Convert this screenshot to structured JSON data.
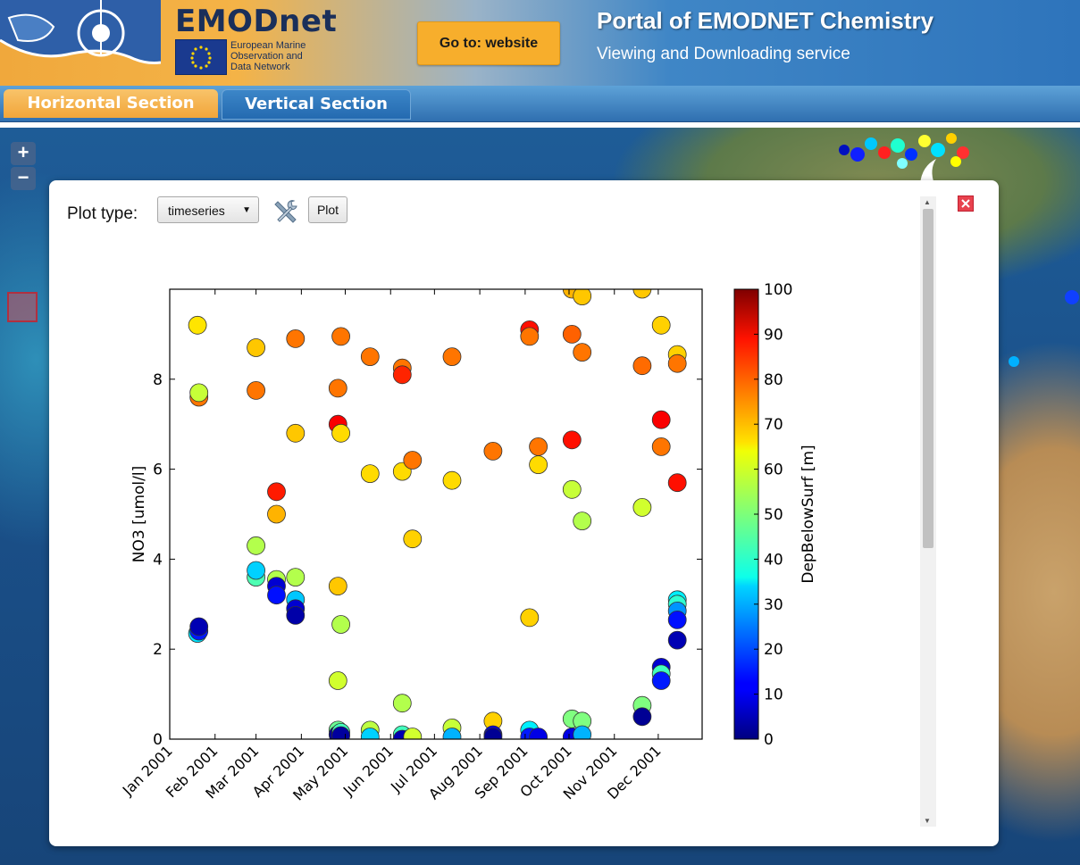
{
  "header": {
    "brand_name": "EMODnet",
    "brand_tagline_1": "European Marine",
    "brand_tagline_2": "Observation and",
    "brand_tagline_3": "Data Network",
    "goto_label": "Go to: website",
    "portal_title": "Portal of EMODNET Chemistry",
    "portal_subtitle": "Viewing and Downloading service"
  },
  "tabs": [
    {
      "label": "Horizontal Section",
      "active": true
    },
    {
      "label": "Vertical Section",
      "active": false
    }
  ],
  "map": {
    "zoom_in": "+",
    "zoom_out": "−"
  },
  "panel": {
    "plot_type_label": "Plot type:",
    "plot_type_value": "timeseries",
    "plot_button": "Plot",
    "close_icon": "close-icon",
    "tools_icon": "tools-icon"
  },
  "colors": {
    "header_orange": "#f4b347",
    "header_blue": "#2e74bb",
    "tab_active": "#f2a63a",
    "tab_inactive": "#246ab0",
    "goto_button": "#f7ae2c"
  },
  "chart_data": {
    "type": "scatter",
    "xlabel": "",
    "ylabel": "NO3 [umol/l]",
    "colorbar_label": "DepBelowSurf [m]",
    "x_tick_labels": [
      "Jan 2001",
      "Feb 2001",
      "Mar 2001",
      "Apr 2001",
      "May 2001",
      "Jun 2001",
      "Jul 2001",
      "Aug 2001",
      "Sep 2001",
      "Oct 2001",
      "Nov 2001",
      "Dec 2001"
    ],
    "xlim": [
      "2001-01-01",
      "2001-12-31"
    ],
    "ylim": [
      0,
      10
    ],
    "y_ticks": [
      0,
      2,
      4,
      6,
      8
    ],
    "colorbar_range": [
      0,
      100
    ],
    "colorbar_ticks": [
      0,
      10,
      20,
      30,
      40,
      50,
      60,
      70,
      80,
      90,
      100
    ],
    "colormap": "jet",
    "grid": false,
    "points": [
      {
        "date": "2001-01-20",
        "no3": 9.2,
        "depth": 65
      },
      {
        "date": "2001-01-21",
        "no3": 7.6,
        "depth": 76
      },
      {
        "date": "2001-01-21",
        "no3": 7.7,
        "depth": 57
      },
      {
        "date": "2001-01-20",
        "no3": 2.35,
        "depth": 35
      },
      {
        "date": "2001-01-21",
        "no3": 2.4,
        "depth": 15
      },
      {
        "date": "2001-01-21",
        "no3": 2.5,
        "depth": 5
      },
      {
        "date": "2001-03-01",
        "no3": 8.7,
        "depth": 68
      },
      {
        "date": "2001-03-01",
        "no3": 7.75,
        "depth": 76
      },
      {
        "date": "2001-03-01",
        "no3": 4.3,
        "depth": 55
      },
      {
        "date": "2001-03-01",
        "no3": 3.6,
        "depth": 45
      },
      {
        "date": "2001-03-01",
        "no3": 3.75,
        "depth": 33
      },
      {
        "date": "2001-03-15",
        "no3": 5.5,
        "depth": 85
      },
      {
        "date": "2001-03-15",
        "no3": 5.0,
        "depth": 70
      },
      {
        "date": "2001-03-15",
        "no3": 3.55,
        "depth": 55
      },
      {
        "date": "2001-03-15",
        "no3": 3.4,
        "depth": 8
      },
      {
        "date": "2001-03-15",
        "no3": 3.2,
        "depth": 14
      },
      {
        "date": "2001-03-28",
        "no3": 8.9,
        "depth": 76
      },
      {
        "date": "2001-03-28",
        "no3": 6.8,
        "depth": 68
      },
      {
        "date": "2001-03-28",
        "no3": 3.6,
        "depth": 55
      },
      {
        "date": "2001-03-28",
        "no3": 3.1,
        "depth": 32
      },
      {
        "date": "2001-03-28",
        "no3": 2.9,
        "depth": 8
      },
      {
        "date": "2001-03-28",
        "no3": 2.75,
        "depth": 4
      },
      {
        "date": "2001-04-26",
        "no3": 7.8,
        "depth": 76
      },
      {
        "date": "2001-04-26",
        "no3": 7.0,
        "depth": 88
      },
      {
        "date": "2001-04-26",
        "no3": 3.4,
        "depth": 68
      },
      {
        "date": "2001-04-26",
        "no3": 1.3,
        "depth": 58
      },
      {
        "date": "2001-04-26",
        "no3": 0.2,
        "depth": 48
      },
      {
        "date": "2001-04-26",
        "no3": 0.1,
        "depth": 2
      },
      {
        "date": "2001-04-28",
        "no3": 8.95,
        "depth": 76
      },
      {
        "date": "2001-04-28",
        "no3": 6.8,
        "depth": 66
      },
      {
        "date": "2001-04-28",
        "no3": 2.55,
        "depth": 55
      },
      {
        "date": "2001-04-28",
        "no3": 0.15,
        "depth": 44
      },
      {
        "date": "2001-04-28",
        "no3": 0.08,
        "depth": 3
      },
      {
        "date": "2001-05-18",
        "no3": 8.5,
        "depth": 76
      },
      {
        "date": "2001-05-18",
        "no3": 5.9,
        "depth": 66
      },
      {
        "date": "2001-05-18",
        "no3": 0.2,
        "depth": 56
      },
      {
        "date": "2001-05-18",
        "no3": 0.05,
        "depth": 33
      },
      {
        "date": "2001-06-09",
        "no3": 8.25,
        "depth": 76
      },
      {
        "date": "2001-06-09",
        "no3": 8.1,
        "depth": 84
      },
      {
        "date": "2001-06-09",
        "no3": 5.95,
        "depth": 66
      },
      {
        "date": "2001-06-09",
        "no3": 0.8,
        "depth": 55
      },
      {
        "date": "2001-06-09",
        "no3": 0.1,
        "depth": 44
      },
      {
        "date": "2001-06-09",
        "no3": 0.0,
        "depth": 5
      },
      {
        "date": "2001-06-16",
        "no3": 6.2,
        "depth": 76
      },
      {
        "date": "2001-06-16",
        "no3": 4.45,
        "depth": 67
      },
      {
        "date": "2001-06-16",
        "no3": 0.05,
        "depth": 58
      },
      {
        "date": "2001-07-13",
        "no3": 8.5,
        "depth": 76
      },
      {
        "date": "2001-07-13",
        "no3": 5.75,
        "depth": 66
      },
      {
        "date": "2001-07-13",
        "no3": 0.25,
        "depth": 57
      },
      {
        "date": "2001-07-13",
        "no3": 0.05,
        "depth": 30
      },
      {
        "date": "2001-08-10",
        "no3": 6.4,
        "depth": 76
      },
      {
        "date": "2001-08-10",
        "no3": 0.4,
        "depth": 67
      },
      {
        "date": "2001-08-10",
        "no3": 0.1,
        "depth": 10
      },
      {
        "date": "2001-08-10",
        "no3": 0.05,
        "depth": 2
      },
      {
        "date": "2001-09-04",
        "no3": 9.1,
        "depth": 86
      },
      {
        "date": "2001-09-04",
        "no3": 8.95,
        "depth": 76
      },
      {
        "date": "2001-09-04",
        "no3": 2.7,
        "depth": 67
      },
      {
        "date": "2001-09-04",
        "no3": 0.2,
        "depth": 36
      },
      {
        "date": "2001-09-04",
        "no3": 0.05,
        "depth": 15
      },
      {
        "date": "2001-09-10",
        "no3": 6.5,
        "depth": 76
      },
      {
        "date": "2001-09-10",
        "no3": 6.1,
        "depth": 66
      },
      {
        "date": "2001-09-10",
        "no3": 0.05,
        "depth": 10
      },
      {
        "date": "2001-10-03",
        "no3": 10.0,
        "depth": 70
      },
      {
        "date": "2001-10-03",
        "no3": 9.0,
        "depth": 78
      },
      {
        "date": "2001-10-03",
        "no3": 6.65,
        "depth": 86
      },
      {
        "date": "2001-10-03",
        "no3": 5.55,
        "depth": 57
      },
      {
        "date": "2001-10-03",
        "no3": 0.45,
        "depth": 50
      },
      {
        "date": "2001-10-03",
        "no3": 0.05,
        "depth": 10
      },
      {
        "date": "2001-10-10",
        "no3": 9.85,
        "depth": 68
      },
      {
        "date": "2001-10-10",
        "no3": 8.6,
        "depth": 76
      },
      {
        "date": "2001-10-10",
        "no3": 4.85,
        "depth": 55
      },
      {
        "date": "2001-10-10",
        "no3": 0.4,
        "depth": 50
      },
      {
        "date": "2001-10-10",
        "no3": 0.1,
        "depth": 30
      },
      {
        "date": "2001-11-20",
        "no3": 10.0,
        "depth": 68
      },
      {
        "date": "2001-11-20",
        "no3": 8.3,
        "depth": 77
      },
      {
        "date": "2001-11-20",
        "no3": 5.15,
        "depth": 58
      },
      {
        "date": "2001-11-20",
        "no3": 0.75,
        "depth": 50
      },
      {
        "date": "2001-11-20",
        "no3": 0.5,
        "depth": 2
      },
      {
        "date": "2001-12-03",
        "no3": 9.2,
        "depth": 67
      },
      {
        "date": "2001-12-03",
        "no3": 7.1,
        "depth": 88
      },
      {
        "date": "2001-12-03",
        "no3": 6.5,
        "depth": 76
      },
      {
        "date": "2001-12-03",
        "no3": 1.6,
        "depth": 8
      },
      {
        "date": "2001-12-03",
        "no3": 1.45,
        "depth": 44
      },
      {
        "date": "2001-12-03",
        "no3": 1.3,
        "depth": 15
      },
      {
        "date": "2001-12-14",
        "no3": 8.55,
        "depth": 67
      },
      {
        "date": "2001-12-14",
        "no3": 8.35,
        "depth": 76
      },
      {
        "date": "2001-12-14",
        "no3": 5.7,
        "depth": 86
      },
      {
        "date": "2001-12-14",
        "no3": 3.1,
        "depth": 36
      },
      {
        "date": "2001-12-14",
        "no3": 3.0,
        "depth": 42
      },
      {
        "date": "2001-12-14",
        "no3": 2.85,
        "depth": 27
      },
      {
        "date": "2001-12-14",
        "no3": 2.65,
        "depth": 14
      },
      {
        "date": "2001-12-14",
        "no3": 2.2,
        "depth": 5
      }
    ]
  }
}
